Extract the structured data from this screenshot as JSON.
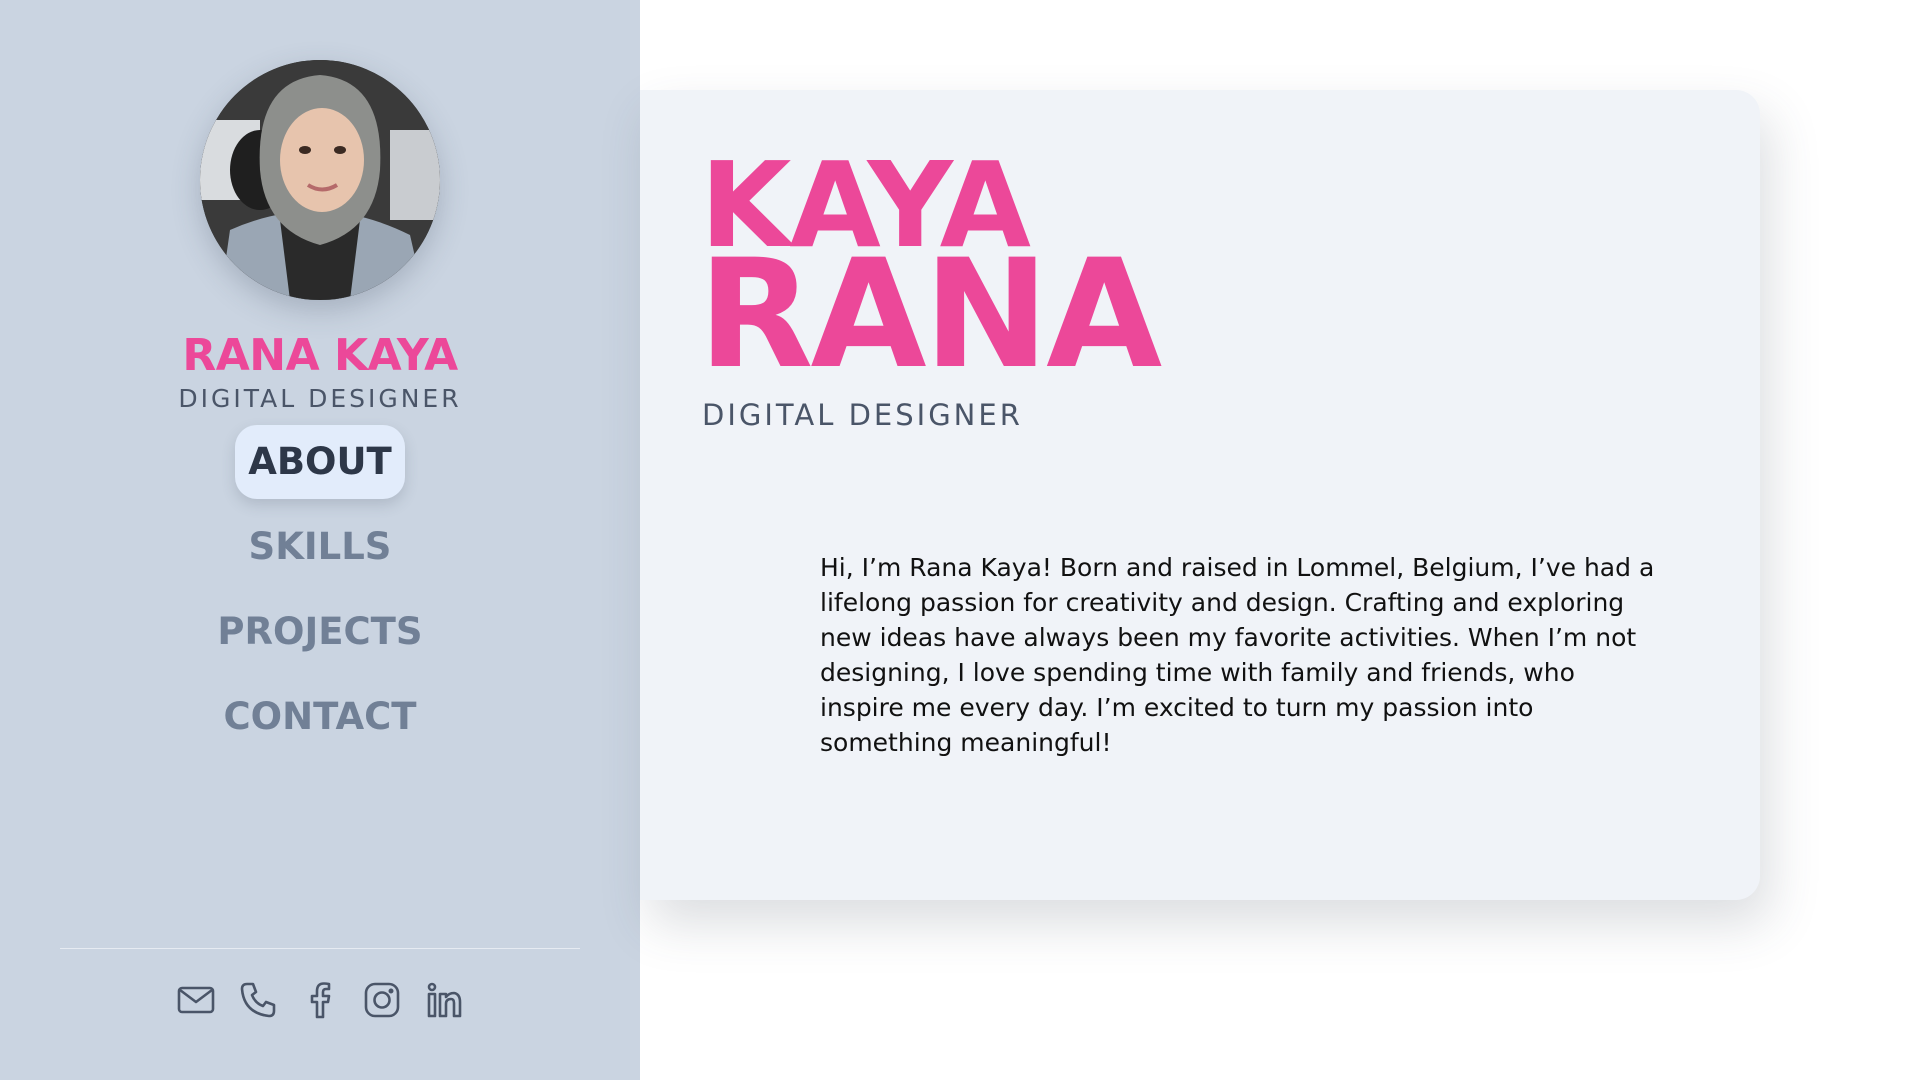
{
  "colors": {
    "accent": "#ec4899",
    "sidebar_bg": "#cad4e1",
    "card_bg": "#f0f3f8",
    "nav_active_bg": "#e2ecfb",
    "nav_text": "#718096",
    "nav_active_text": "#2d3748",
    "role_text": "#4a5568",
    "icon_stroke": "#4a5568"
  },
  "sidebar": {
    "name": "RANA KAYA",
    "role": "DIGITAL DESIGNER",
    "nav": [
      {
        "label": "ABOUT",
        "active": true
      },
      {
        "label": "SKILLS",
        "active": false
      },
      {
        "label": "PROJECTS",
        "active": false
      },
      {
        "label": "CONTACT",
        "active": false
      }
    ],
    "socials": [
      "mail-icon",
      "phone-icon",
      "facebook-icon",
      "instagram-icon",
      "linkedin-icon"
    ]
  },
  "main": {
    "first_line": "KAYA",
    "second_line": "RANA",
    "role": "DIGITAL DESIGNER",
    "bio": "Hi, I’m Rana Kaya! Born and raised in Lommel, Belgium, I’ve had a lifelong passion for creativity and design. Crafting and exploring new ideas have always been my favorite activities. When I’m not designing, I love spending time with family and friends, who inspire me every day. I’m excited to turn my passion into something meaningful!"
  }
}
